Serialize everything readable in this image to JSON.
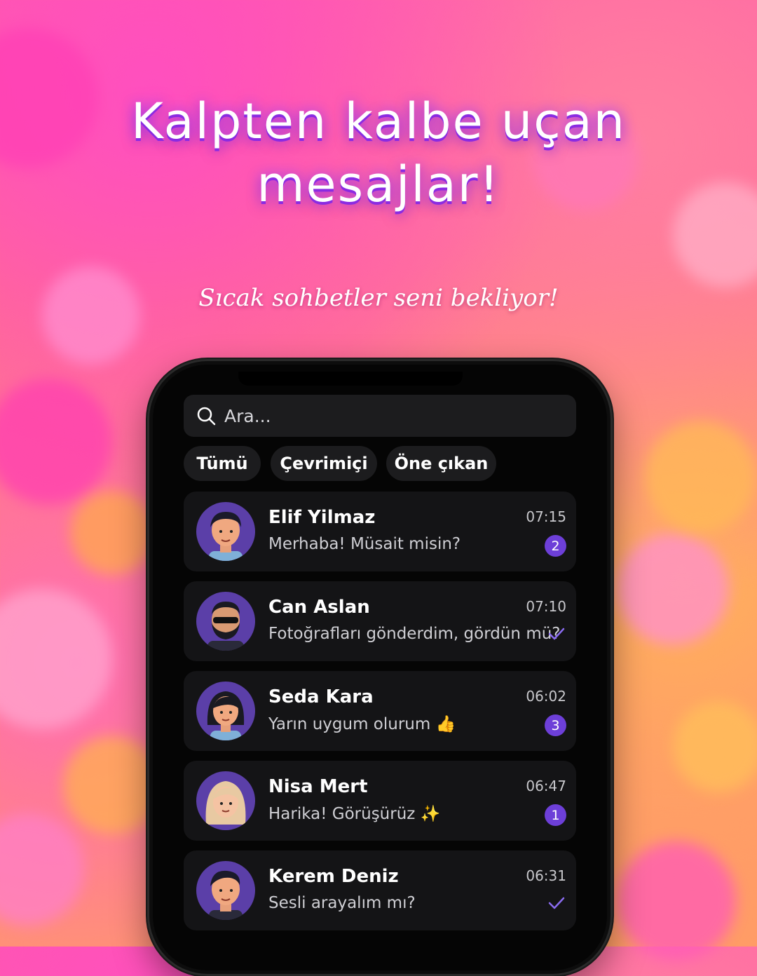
{
  "headline": {
    "line1": "Kalpten kalbe uçan",
    "line2": "mesajlar!"
  },
  "subline": "Sıcak sohbetler seni bekliyor!",
  "search": {
    "placeholder": "Ara...",
    "icon": "search-icon"
  },
  "filters": [
    "Tümü",
    "Çevrimiçi",
    "Öne çıkan"
  ],
  "chats": [
    {
      "name": "Elif Yilmaz",
      "message": "Merhaba! Müsait misin?",
      "time": "07:15",
      "unread": "2"
    },
    {
      "name": "Can Aslan",
      "message": "Fotoğrafları gönderdim, gördün mü?",
      "time": "07:10",
      "status": "read"
    },
    {
      "name": "Seda Kara",
      "message": "Yarın uygum olurum 👍",
      "time": "06:02",
      "unread": "3"
    },
    {
      "name": "Nisa Mert",
      "message": "Harika! Görüşürüz ✨",
      "time": "06:47",
      "unread": "1"
    },
    {
      "name": "Kerem Deniz",
      "message": "Sesli arayalım mı?",
      "time": "06:31",
      "status": "read"
    }
  ],
  "colors": {
    "accent": "#6d3fd8",
    "avatar_bg": "#5b3fa8",
    "row_bg": "#141416"
  }
}
